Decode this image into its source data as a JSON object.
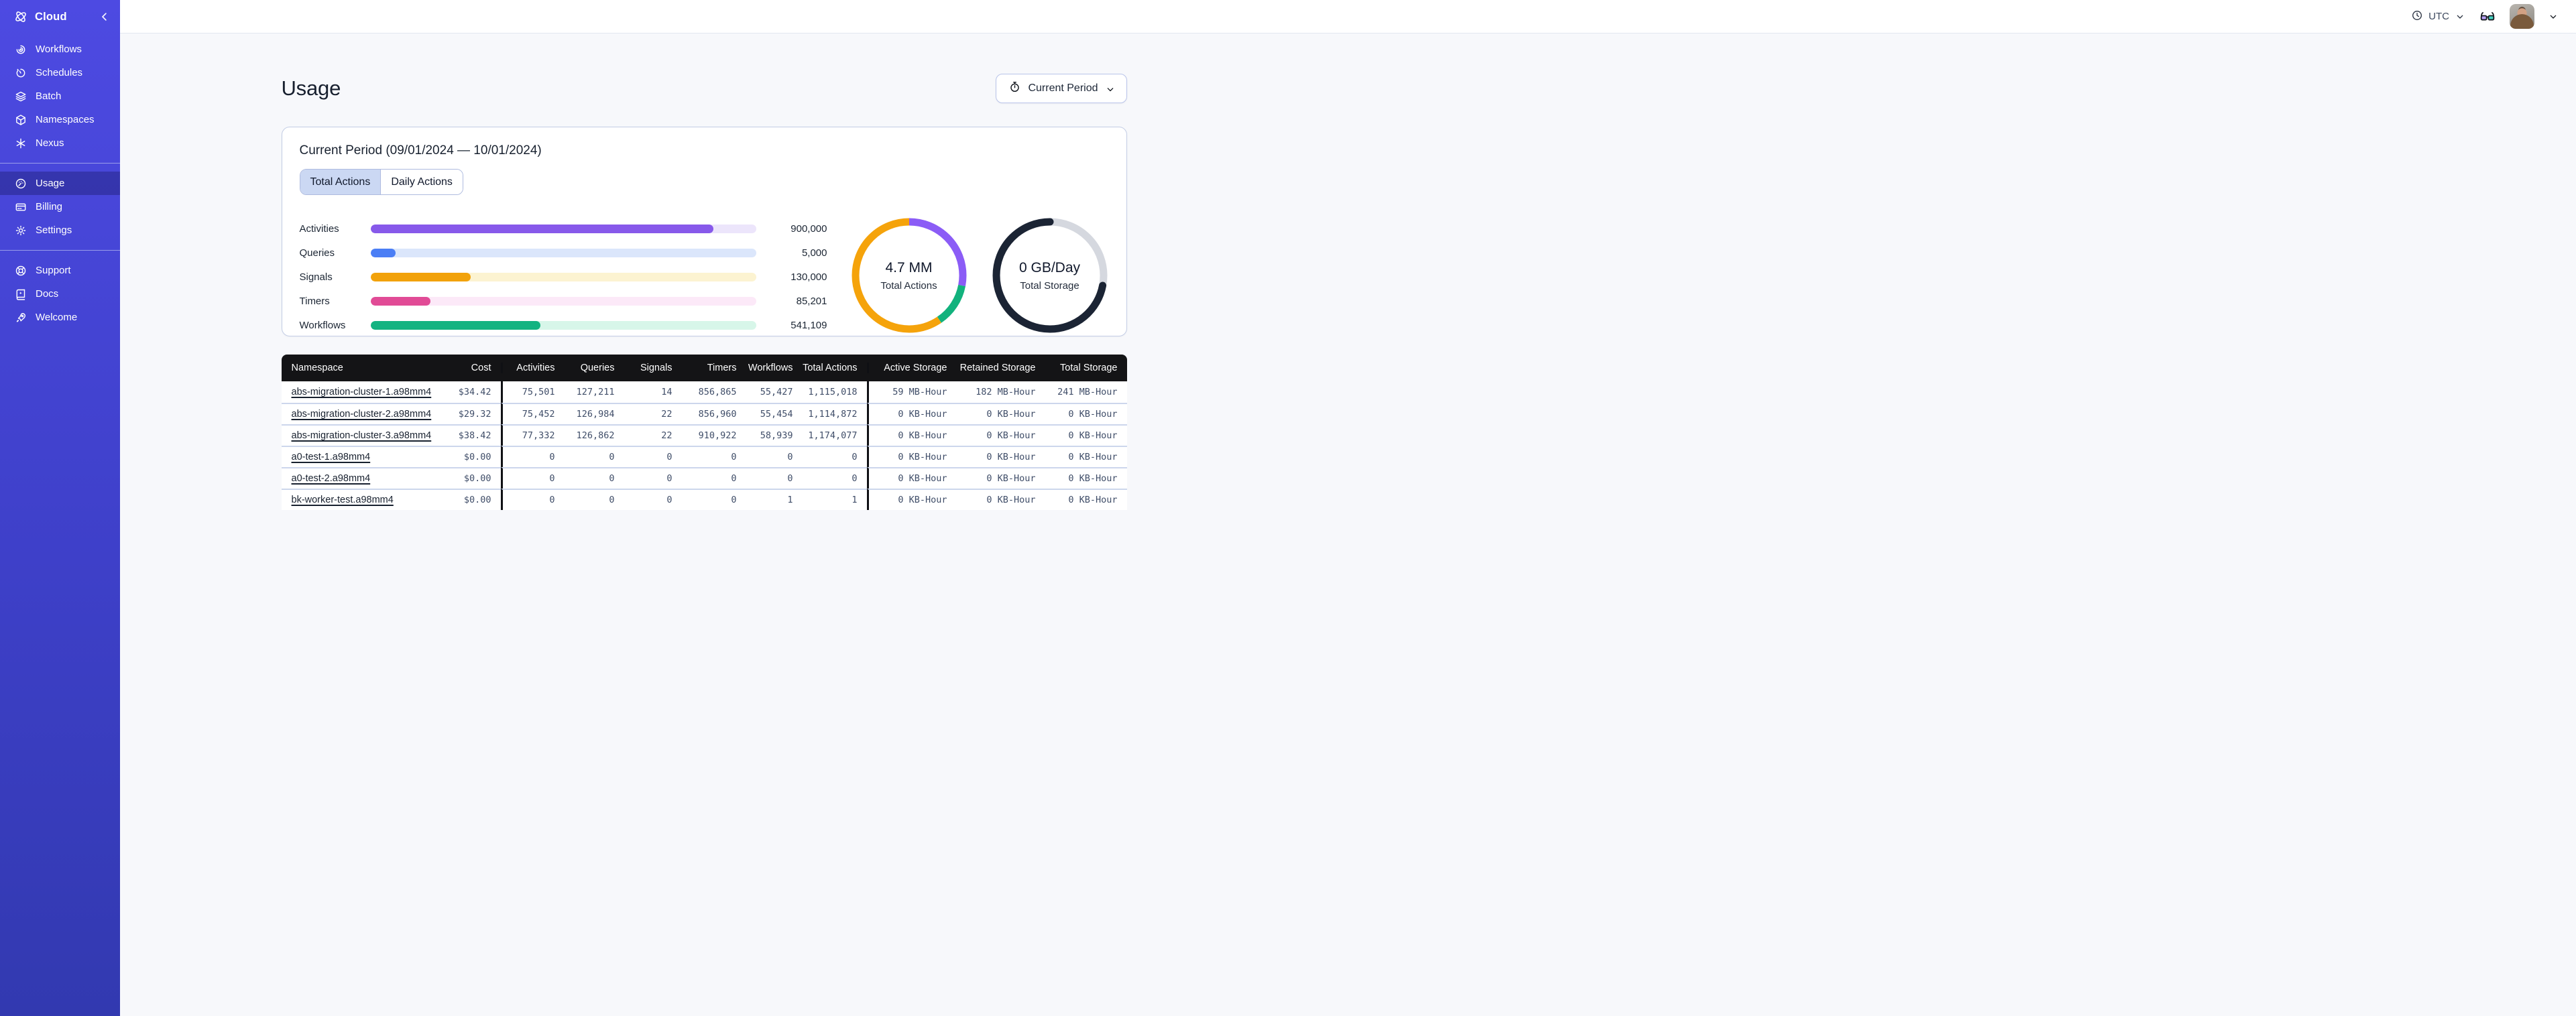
{
  "topbar": {
    "timezone_label": "UTC"
  },
  "sidebar": {
    "header": {
      "label": "Cloud"
    },
    "sections": [
      {
        "items": [
          {
            "label": "Workflows",
            "icon": "workflows-icon",
            "active": false
          },
          {
            "label": "Schedules",
            "icon": "schedules-icon",
            "active": false
          },
          {
            "label": "Batch",
            "icon": "batch-icon",
            "active": false
          },
          {
            "label": "Namespaces",
            "icon": "namespaces-icon",
            "active": false
          },
          {
            "label": "Nexus",
            "icon": "nexus-icon",
            "active": false
          }
        ]
      },
      {
        "items": [
          {
            "label": "Usage",
            "icon": "usage-icon",
            "active": true
          },
          {
            "label": "Billing",
            "icon": "billing-icon",
            "active": false
          },
          {
            "label": "Settings",
            "icon": "settings-icon",
            "active": false
          }
        ]
      },
      {
        "items": [
          {
            "label": "Support",
            "icon": "support-icon",
            "active": false
          },
          {
            "label": "Docs",
            "icon": "docs-icon",
            "active": false
          },
          {
            "label": "Welcome",
            "icon": "welcome-icon",
            "active": false
          }
        ]
      }
    ]
  },
  "page": {
    "title": "Usage",
    "period_button": {
      "label": "Current Period",
      "icon": "stopwatch-icon"
    }
  },
  "card": {
    "title": "Current Period (09/01/2024 — 10/01/2024)",
    "tabs": [
      {
        "label": "Total Actions",
        "active": true
      },
      {
        "label": "Daily Actions",
        "active": false
      }
    ]
  },
  "chart_data": [
    {
      "type": "bar",
      "orientation": "horizontal",
      "categories": [
        "Activities",
        "Queries",
        "Signals",
        "Timers",
        "Workflows"
      ],
      "values": [
        900000,
        5000,
        130000,
        85201,
        541109
      ],
      "value_labels": [
        "900,000",
        "5,000",
        "130,000",
        "85,201",
        "541,109"
      ],
      "fill_pct": [
        89,
        6.5,
        26,
        15.5,
        44
      ],
      "colors": [
        "#8759ea",
        "#4b7ef5",
        "#f2a20b",
        "#e14b96",
        "#13b381"
      ],
      "track_colors": [
        "#ece5fb",
        "#dbe6fb",
        "#fcf3d1",
        "#fce9f8",
        "#d7f6e9"
      ],
      "grid": false,
      "legend": false
    },
    {
      "type": "pie",
      "title": "4.7 MM",
      "subtitle": "Total Actions",
      "slices": [
        {
          "label": "segment-purple",
          "pct": 28,
          "color": "#8b5cf6"
        },
        {
          "label": "segment-green",
          "pct": 12.5,
          "color": "#12b27d"
        },
        {
          "label": "segment-orange",
          "pct": 59.5,
          "color": "#f5a30b"
        }
      ],
      "donut": true
    },
    {
      "type": "pie",
      "title": "0 GB/Day",
      "subtitle": "Total Storage",
      "slices": [
        {
          "label": "filled",
          "pct": 72,
          "color": "#1b2434",
          "start_pct": 28,
          "linecap": "round"
        },
        {
          "label": "track",
          "pct": 28,
          "color": "#d5d8df"
        }
      ],
      "donut": true
    }
  ],
  "table": {
    "columns": [
      "Namespace",
      "Cost",
      "Activities",
      "Queries",
      "Signals",
      "Timers",
      "Workflows",
      "Total Actions",
      "Active Storage",
      "Retained Storage",
      "Total Storage"
    ],
    "rows": [
      [
        "abs-migration-cluster-1.a98mm4",
        "$34.42",
        "75,501",
        "127,211",
        "14",
        "856,865",
        "55,427",
        "1,115,018",
        "59 MB-Hour",
        "182 MB-Hour",
        "241 MB-Hour"
      ],
      [
        "abs-migration-cluster-2.a98mm4",
        "$29.32",
        "75,452",
        "126,984",
        "22",
        "856,960",
        "55,454",
        "1,114,872",
        "0 KB-Hour",
        "0 KB-Hour",
        "0 KB-Hour"
      ],
      [
        "abs-migration-cluster-3.a98mm4",
        "$38.42",
        "77,332",
        "126,862",
        "22",
        "910,922",
        "58,939",
        "1,174,077",
        "0 KB-Hour",
        "0 KB-Hour",
        "0 KB-Hour"
      ],
      [
        "a0-test-1.a98mm4",
        "$0.00",
        "0",
        "0",
        "0",
        "0",
        "0",
        "0",
        "0 KB-Hour",
        "0 KB-Hour",
        "0 KB-Hour"
      ],
      [
        "a0-test-2.a98mm4",
        "$0.00",
        "0",
        "0",
        "0",
        "0",
        "0",
        "0",
        "0 KB-Hour",
        "0 KB-Hour",
        "0 KB-Hour"
      ],
      [
        "bk-worker-test.a98mm4",
        "$0.00",
        "0",
        "0",
        "0",
        "0",
        "1",
        "1",
        "0 KB-Hour",
        "0 KB-Hour",
        "0 KB-Hour"
      ]
    ]
  },
  "colors": {
    "sidebar_top": "#4d4ae2",
    "sidebar_bottom": "#3239b0",
    "table_header_bg": "#141416",
    "card_border": "#c3cde5",
    "accent_border": "#b9c4ea",
    "tab_active_bg": "#cbd8f3"
  }
}
